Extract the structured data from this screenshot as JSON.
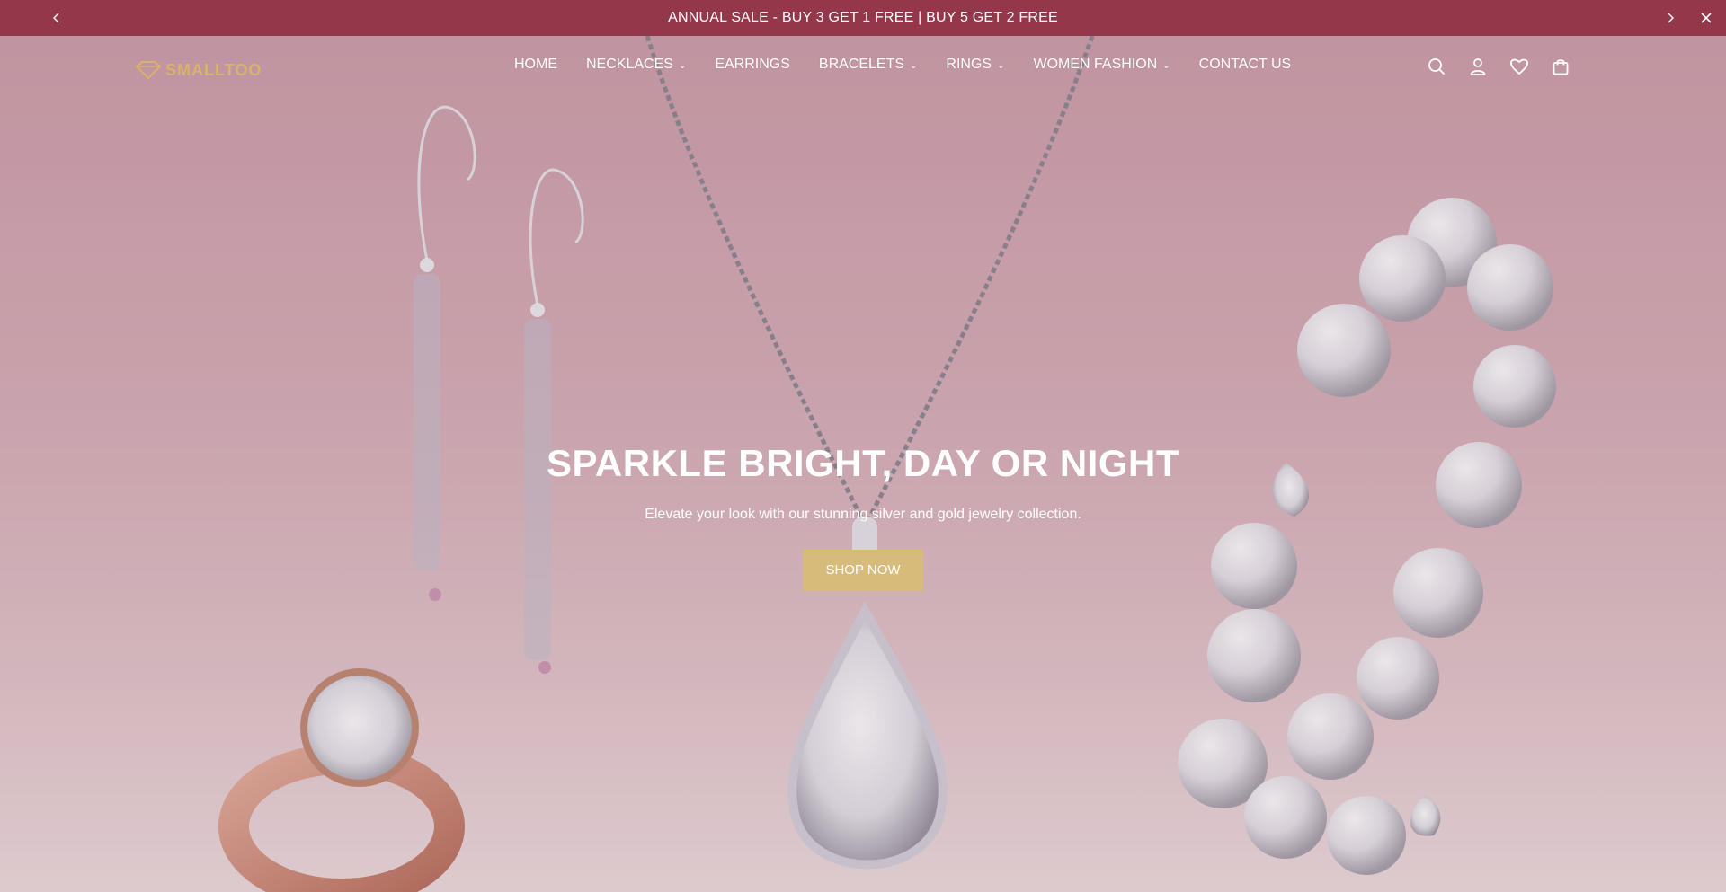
{
  "announcement": {
    "text": "ANNUAL SALE - BUY 3 GET 1 FREE | BUY 5 GET 2 FREE",
    "prev_icon": "chevron-left-icon",
    "next_icon": "chevron-right-icon",
    "close_icon": "close-icon",
    "bg_color": "#94374a"
  },
  "brand": {
    "logo_text": "SMALLTOO",
    "logo_color": "#d8b36b"
  },
  "nav": {
    "items": [
      {
        "label": "HOME",
        "has_dropdown": false
      },
      {
        "label": "NECKLACES",
        "has_dropdown": true
      },
      {
        "label": "EARRINGS",
        "has_dropdown": false
      },
      {
        "label": "BRACELETS",
        "has_dropdown": true
      },
      {
        "label": "RINGS",
        "has_dropdown": true
      },
      {
        "label": "WOMEN FASHION",
        "has_dropdown": true
      },
      {
        "label": "CONTACT US",
        "has_dropdown": false
      }
    ]
  },
  "header_icons": [
    "search-icon",
    "account-icon",
    "wishlist-heart-icon",
    "cart-bag-icon"
  ],
  "hero": {
    "title": "SPARKLE BRIGHT, DAY OR NIGHT",
    "subtitle": "Elevate your look with our stunning silver and gold jewelry collection.",
    "cta_label": "SHOP NOW",
    "cta_color": "#d7bb7b"
  }
}
